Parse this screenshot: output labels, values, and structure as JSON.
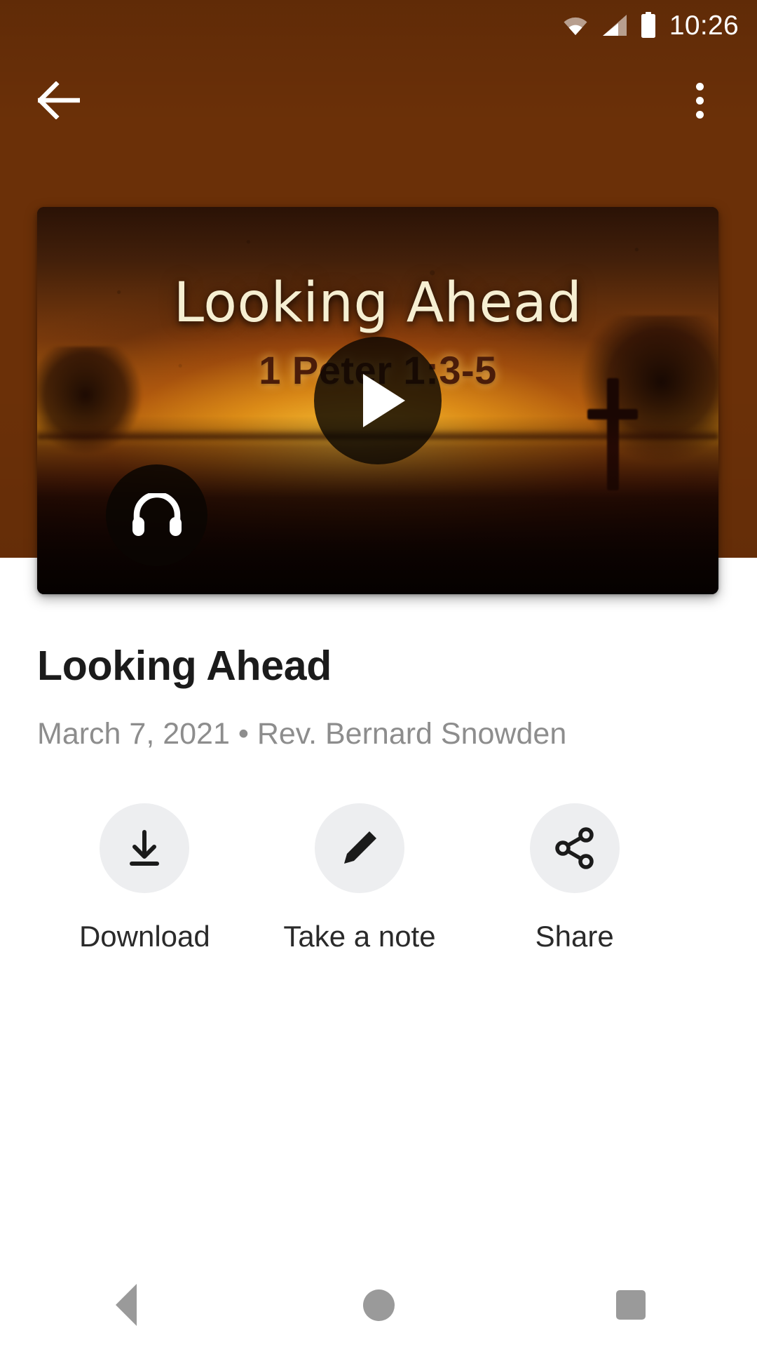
{
  "status_bar": {
    "time": "10:26",
    "icons": [
      "wifi-icon",
      "cellular-signal-icon",
      "battery-icon"
    ]
  },
  "toolbar": {
    "back_icon": "back-arrow-icon",
    "overflow_icon": "more-vert-icon"
  },
  "media": {
    "artwork_title": "Looking Ahead",
    "artwork_reference": "1 Peter 1:3-5",
    "play_icon": "play-icon",
    "audio_icon": "headphones-icon",
    "artwork_description": "Sunset sky with cross silhouette and trees"
  },
  "detail": {
    "title": "Looking Ahead",
    "meta": "March 7, 2021 • Rev. Bernard Snowden",
    "date": "March 7, 2021",
    "speaker": "Rev. Bernard Snowden"
  },
  "actions": [
    {
      "label": "Download",
      "icon": "download-icon"
    },
    {
      "label": "Take a note",
      "icon": "pencil-icon"
    },
    {
      "label": "Share",
      "icon": "share-icon"
    }
  ],
  "nav_bar": {
    "back": "nav-back-triangle-icon",
    "home": "nav-home-circle-icon",
    "recents": "nav-recents-square-icon"
  },
  "colors": {
    "header_brown": "#6B3008",
    "sheet_white": "#FFFFFF",
    "action_circle": "#EDEEF0",
    "title_text": "#1B1B1B",
    "meta_text": "#8D8D8D",
    "nav_icon": "#9A9A9A",
    "artwork_title_text": "#F6EFD2",
    "artwork_ref_text": "#4A1C09"
  }
}
